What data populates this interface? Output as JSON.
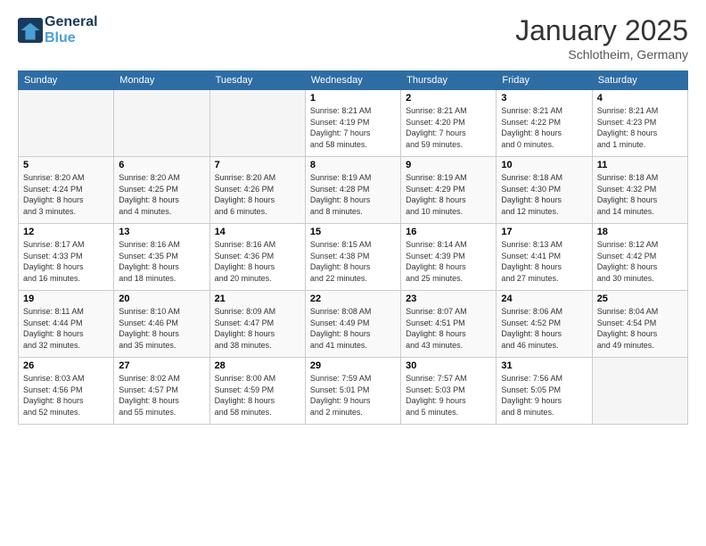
{
  "header": {
    "logo_line1": "General",
    "logo_line2": "Blue",
    "month_title": "January 2025",
    "location": "Schlotheim, Germany"
  },
  "weekdays": [
    "Sunday",
    "Monday",
    "Tuesday",
    "Wednesday",
    "Thursday",
    "Friday",
    "Saturday"
  ],
  "weeks": [
    [
      {
        "day": "",
        "info": ""
      },
      {
        "day": "",
        "info": ""
      },
      {
        "day": "",
        "info": ""
      },
      {
        "day": "1",
        "info": "Sunrise: 8:21 AM\nSunset: 4:19 PM\nDaylight: 7 hours\nand 58 minutes."
      },
      {
        "day": "2",
        "info": "Sunrise: 8:21 AM\nSunset: 4:20 PM\nDaylight: 7 hours\nand 59 minutes."
      },
      {
        "day": "3",
        "info": "Sunrise: 8:21 AM\nSunset: 4:22 PM\nDaylight: 8 hours\nand 0 minutes."
      },
      {
        "day": "4",
        "info": "Sunrise: 8:21 AM\nSunset: 4:23 PM\nDaylight: 8 hours\nand 1 minute."
      }
    ],
    [
      {
        "day": "5",
        "info": "Sunrise: 8:20 AM\nSunset: 4:24 PM\nDaylight: 8 hours\nand 3 minutes."
      },
      {
        "day": "6",
        "info": "Sunrise: 8:20 AM\nSunset: 4:25 PM\nDaylight: 8 hours\nand 4 minutes."
      },
      {
        "day": "7",
        "info": "Sunrise: 8:20 AM\nSunset: 4:26 PM\nDaylight: 8 hours\nand 6 minutes."
      },
      {
        "day": "8",
        "info": "Sunrise: 8:19 AM\nSunset: 4:28 PM\nDaylight: 8 hours\nand 8 minutes."
      },
      {
        "day": "9",
        "info": "Sunrise: 8:19 AM\nSunset: 4:29 PM\nDaylight: 8 hours\nand 10 minutes."
      },
      {
        "day": "10",
        "info": "Sunrise: 8:18 AM\nSunset: 4:30 PM\nDaylight: 8 hours\nand 12 minutes."
      },
      {
        "day": "11",
        "info": "Sunrise: 8:18 AM\nSunset: 4:32 PM\nDaylight: 8 hours\nand 14 minutes."
      }
    ],
    [
      {
        "day": "12",
        "info": "Sunrise: 8:17 AM\nSunset: 4:33 PM\nDaylight: 8 hours\nand 16 minutes."
      },
      {
        "day": "13",
        "info": "Sunrise: 8:16 AM\nSunset: 4:35 PM\nDaylight: 8 hours\nand 18 minutes."
      },
      {
        "day": "14",
        "info": "Sunrise: 8:16 AM\nSunset: 4:36 PM\nDaylight: 8 hours\nand 20 minutes."
      },
      {
        "day": "15",
        "info": "Sunrise: 8:15 AM\nSunset: 4:38 PM\nDaylight: 8 hours\nand 22 minutes."
      },
      {
        "day": "16",
        "info": "Sunrise: 8:14 AM\nSunset: 4:39 PM\nDaylight: 8 hours\nand 25 minutes."
      },
      {
        "day": "17",
        "info": "Sunrise: 8:13 AM\nSunset: 4:41 PM\nDaylight: 8 hours\nand 27 minutes."
      },
      {
        "day": "18",
        "info": "Sunrise: 8:12 AM\nSunset: 4:42 PM\nDaylight: 8 hours\nand 30 minutes."
      }
    ],
    [
      {
        "day": "19",
        "info": "Sunrise: 8:11 AM\nSunset: 4:44 PM\nDaylight: 8 hours\nand 32 minutes."
      },
      {
        "day": "20",
        "info": "Sunrise: 8:10 AM\nSunset: 4:46 PM\nDaylight: 8 hours\nand 35 minutes."
      },
      {
        "day": "21",
        "info": "Sunrise: 8:09 AM\nSunset: 4:47 PM\nDaylight: 8 hours\nand 38 minutes."
      },
      {
        "day": "22",
        "info": "Sunrise: 8:08 AM\nSunset: 4:49 PM\nDaylight: 8 hours\nand 41 minutes."
      },
      {
        "day": "23",
        "info": "Sunrise: 8:07 AM\nSunset: 4:51 PM\nDaylight: 8 hours\nand 43 minutes."
      },
      {
        "day": "24",
        "info": "Sunrise: 8:06 AM\nSunset: 4:52 PM\nDaylight: 8 hours\nand 46 minutes."
      },
      {
        "day": "25",
        "info": "Sunrise: 8:04 AM\nSunset: 4:54 PM\nDaylight: 8 hours\nand 49 minutes."
      }
    ],
    [
      {
        "day": "26",
        "info": "Sunrise: 8:03 AM\nSunset: 4:56 PM\nDaylight: 8 hours\nand 52 minutes."
      },
      {
        "day": "27",
        "info": "Sunrise: 8:02 AM\nSunset: 4:57 PM\nDaylight: 8 hours\nand 55 minutes."
      },
      {
        "day": "28",
        "info": "Sunrise: 8:00 AM\nSunset: 4:59 PM\nDaylight: 8 hours\nand 58 minutes."
      },
      {
        "day": "29",
        "info": "Sunrise: 7:59 AM\nSunset: 5:01 PM\nDaylight: 9 hours\nand 2 minutes."
      },
      {
        "day": "30",
        "info": "Sunrise: 7:57 AM\nSunset: 5:03 PM\nDaylight: 9 hours\nand 5 minutes."
      },
      {
        "day": "31",
        "info": "Sunrise: 7:56 AM\nSunset: 5:05 PM\nDaylight: 9 hours\nand 8 minutes."
      },
      {
        "day": "",
        "info": ""
      }
    ]
  ]
}
